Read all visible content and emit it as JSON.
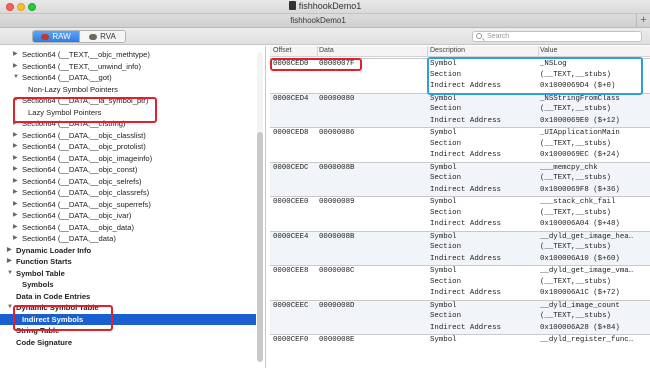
{
  "window": {
    "title": "fishhookDemo1",
    "tab_title": "fishhookDemo1",
    "add_tab": "+"
  },
  "toolbar": {
    "raw_label": "RAW",
    "rva_label": "RVA",
    "search_placeholder": "Search"
  },
  "sidebar": {
    "items": [
      {
        "label": "Section64 (__TEXT,__objc_methtype)",
        "indent": 1,
        "arrow": "right",
        "bold": false
      },
      {
        "label": "Section64 (__TEXT,__unwind_info)",
        "indent": 1,
        "arrow": "right",
        "bold": false
      },
      {
        "label": "Section64 (__DATA,__got)",
        "indent": 1,
        "arrow": "down",
        "bold": false
      },
      {
        "label": "Non-Lazy Symbol Pointers",
        "indent": 2,
        "arrow": "",
        "bold": false
      },
      {
        "label": "Section64 (__DATA,__la_symbol_ptr)",
        "indent": 1,
        "arrow": "down",
        "bold": false
      },
      {
        "label": "Lazy Symbol Pointers",
        "indent": 2,
        "arrow": "",
        "bold": false
      },
      {
        "label": "Section64 (__DATA,__cfstring)",
        "indent": 1,
        "arrow": "right",
        "bold": false
      },
      {
        "label": "Section64 (__DATA,__objc_classlist)",
        "indent": 1,
        "arrow": "right",
        "bold": false
      },
      {
        "label": "Section64 (__DATA,__objc_protolist)",
        "indent": 1,
        "arrow": "right",
        "bold": false
      },
      {
        "label": "Section64 (__DATA,__objc_imageinfo)",
        "indent": 1,
        "arrow": "right",
        "bold": false
      },
      {
        "label": "Section64 (__DATA,__objc_const)",
        "indent": 1,
        "arrow": "right",
        "bold": false
      },
      {
        "label": "Section64 (__DATA,__objc_selrefs)",
        "indent": 1,
        "arrow": "right",
        "bold": false
      },
      {
        "label": "Section64 (__DATA,__objc_classrefs)",
        "indent": 1,
        "arrow": "right",
        "bold": false
      },
      {
        "label": "Section64 (__DATA,__objc_superrefs)",
        "indent": 1,
        "arrow": "right",
        "bold": false
      },
      {
        "label": "Section64 (__DATA,__objc_ivar)",
        "indent": 1,
        "arrow": "right",
        "bold": false
      },
      {
        "label": "Section64 (__DATA,__objc_data)",
        "indent": 1,
        "arrow": "right",
        "bold": false
      },
      {
        "label": "Section64 (__DATA,__data)",
        "indent": 1,
        "arrow": "right",
        "bold": false
      },
      {
        "label": "Dynamic Loader Info",
        "indent": 0,
        "arrow": "right",
        "bold": true
      },
      {
        "label": "Function Starts",
        "indent": 0,
        "arrow": "right",
        "bold": true
      },
      {
        "label": "Symbol Table",
        "indent": 0,
        "arrow": "down",
        "bold": true
      },
      {
        "label": "Symbols",
        "indent": 1,
        "arrow": "",
        "bold": true
      },
      {
        "label": "Data in Code Entries",
        "indent": 0,
        "arrow": "",
        "bold": true
      },
      {
        "label": "Dynamic Symbol Table",
        "indent": 0,
        "arrow": "down",
        "bold": true
      },
      {
        "label": "Indirect Symbols",
        "indent": 1,
        "arrow": "",
        "bold": true,
        "selected": true
      },
      {
        "label": "String Table",
        "indent": 0,
        "arrow": "",
        "bold": true
      },
      {
        "label": "Code Signature",
        "indent": 0,
        "arrow": "",
        "bold": true
      }
    ]
  },
  "table": {
    "headers": {
      "offset": "Offset",
      "data": "Data",
      "description": "Description",
      "value": "Value"
    },
    "groups": [
      {
        "offset": "0000CED0",
        "data": "0000007F",
        "symbol": "_NSLog",
        "section": "(__TEXT,__stubs)",
        "address": "0x1000069D4 ($+0)"
      },
      {
        "offset": "0000CED4",
        "data": "00000080",
        "symbol": "_NSStringFromClass",
        "section": "(__TEXT,__stubs)",
        "address": "0x1000069E0 ($+12)"
      },
      {
        "offset": "0000CED8",
        "data": "00000086",
        "symbol": "_UIApplicationMain",
        "section": "(__TEXT,__stubs)",
        "address": "0x1000069EC ($+24)"
      },
      {
        "offset": "0000CEDC",
        "data": "0000008B",
        "symbol": "___memcpy_chk",
        "section": "(__TEXT,__stubs)",
        "address": "0x1000069F8 ($+36)"
      },
      {
        "offset": "0000CEE0",
        "data": "00000089",
        "symbol": "___stack_chk_fail",
        "section": "(__TEXT,__stubs)",
        "address": "0x100006A04 ($+48)"
      },
      {
        "offset": "0000CEE4",
        "data": "0000008B",
        "symbol": "__dyld_get_image_hea…",
        "section": "(__TEXT,__stubs)",
        "address": "0x100006A10 ($+60)"
      },
      {
        "offset": "0000CEE8",
        "data": "0000008C",
        "symbol": "__dyld_get_image_vma…",
        "section": "(__TEXT,__stubs)",
        "address": "0x100006A1C ($+72)"
      },
      {
        "offset": "0000CEEC",
        "data": "0000008D",
        "symbol": "__dyld_image_count",
        "section": "(__TEXT,__stubs)",
        "address": "0x100006A28 ($+84)"
      },
      {
        "offset": "0000CEF0",
        "data": "0000008E",
        "symbol": "__dyld_register_func…",
        "section": "",
        "address": ""
      }
    ],
    "row_labels": {
      "symbol": "Symbol",
      "section": "Section",
      "address": "Indirect Address"
    }
  }
}
